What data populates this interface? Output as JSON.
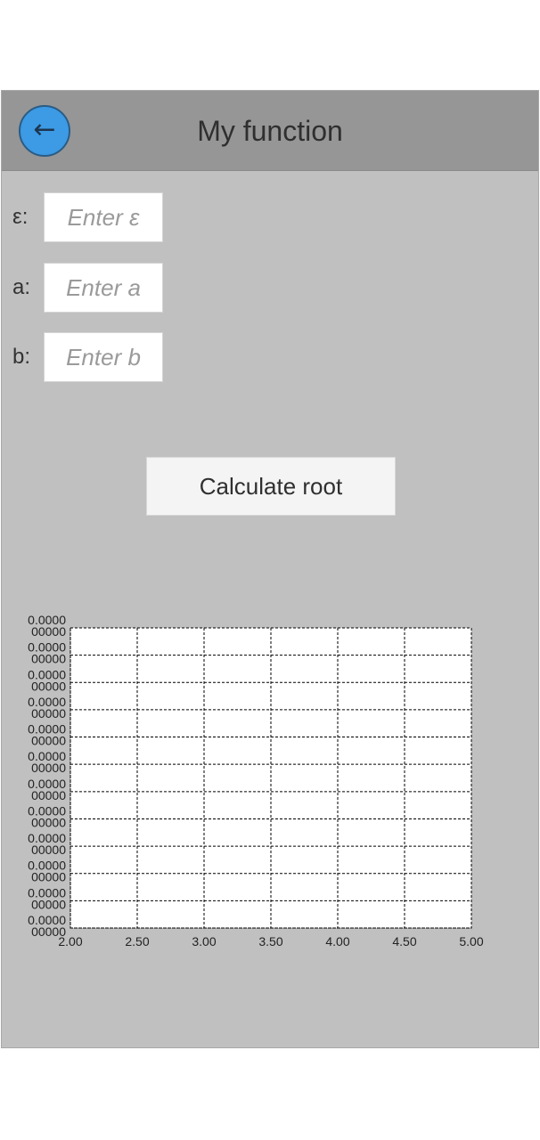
{
  "header": {
    "title": "My function",
    "back_icon": "←"
  },
  "form": {
    "epsilon": {
      "label": "ε:",
      "placeholder": "Enter ε",
      "value": ""
    },
    "a": {
      "label": "a:",
      "placeholder": "Enter a",
      "value": ""
    },
    "b": {
      "label": "b:",
      "placeholder": "Enter b",
      "value": ""
    }
  },
  "calculate_button": {
    "label": "Calculate root"
  },
  "colors": {
    "app_bg": "#c0c0c0",
    "header_bg": "#969696",
    "back_button": "#3d9ae4"
  },
  "chart_data": {
    "type": "line",
    "x": [],
    "values": [],
    "xlim": [
      2.0,
      5.0
    ],
    "x_ticks": [
      "2.00",
      "2.50",
      "3.00",
      "3.50",
      "4.00",
      "4.50",
      "5.00"
    ],
    "y_ticks": [
      "0.0000000",
      "0.0000000",
      "0.0000000",
      "0.0000000",
      "0.0000000",
      "0.0000000",
      "0.0000000",
      "0.0000000",
      "0.0000000",
      "0.0000000",
      "0.0000000",
      "0.0000000"
    ],
    "grid": true,
    "grid_style": "dashed"
  }
}
